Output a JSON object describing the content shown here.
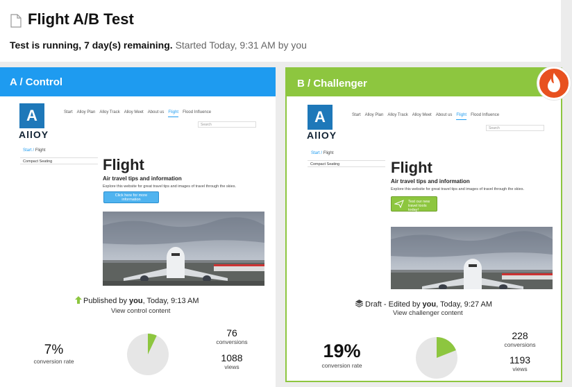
{
  "header": {
    "title": "Flight A/B Test",
    "status_strong": "Test is running, 7 day(s) remaining.",
    "status_muted": "Started Today, 9:31 AM by you"
  },
  "variant_a": {
    "label": "A / Control",
    "preview": {
      "logo_letter": "A",
      "logo_text": "AllOY",
      "nav": [
        "Start",
        "Alloy Plan",
        "Alloy Track",
        "Alloy Meet",
        "About us",
        "Flight",
        "Flood Influence"
      ],
      "search_placeholder": "Search",
      "breadcrumb_start": "Start",
      "breadcrumb_current": "Flight",
      "side_item": "Compact Seating",
      "page_title": "Flight",
      "subtitle": "Air travel tips and information",
      "intro": "Explore this website for great travel tips and images of travel through the skies.",
      "cta_line1": "Click here for more",
      "cta_line2": "information"
    },
    "meta_prefix": "Published by ",
    "meta_user": "you",
    "meta_suffix": ", Today, 9:13 AM",
    "view_link": "View control content",
    "conversion_rate": "7%",
    "conversion_rate_value": 7,
    "conversion_rate_label": "conversion rate",
    "conversions": "76",
    "conversions_label": "conversions",
    "views": "1088",
    "views_label": "views"
  },
  "variant_b": {
    "label": "B / Challenger",
    "preview": {
      "logo_letter": "A",
      "logo_text": "AllOY",
      "nav": [
        "Start",
        "Alloy Plan",
        "Alloy Track",
        "Alloy Meet",
        "About us",
        "Flight",
        "Flood Influence"
      ],
      "search_placeholder": "Search",
      "breadcrumb_start": "Start",
      "breadcrumb_current": "Flight",
      "side_item": "Compact Seating",
      "page_title": "Flight",
      "subtitle": "Air travel tips and information",
      "intro": "Explore this website for great travel tips and images of travel through the skies.",
      "cta_line1": "Test our new",
      "cta_line2": "travel tools today!"
    },
    "meta_prefix": "Draft - Edited by ",
    "meta_user": "you",
    "meta_suffix": ", Today, 9:27 AM",
    "view_link": "View challenger content",
    "conversion_rate": "19%",
    "conversion_rate_value": 19,
    "conversion_rate_label": "conversion rate",
    "conversions": "228",
    "conversions_label": "conversions",
    "views": "1193",
    "views_label": "views"
  },
  "colors": {
    "control": "#1e9bf0",
    "challenger": "#8dc63f",
    "winner_badge": "#e8511f",
    "pie_base": "#e6e6e6",
    "pie_fill": "#8dc63f"
  }
}
